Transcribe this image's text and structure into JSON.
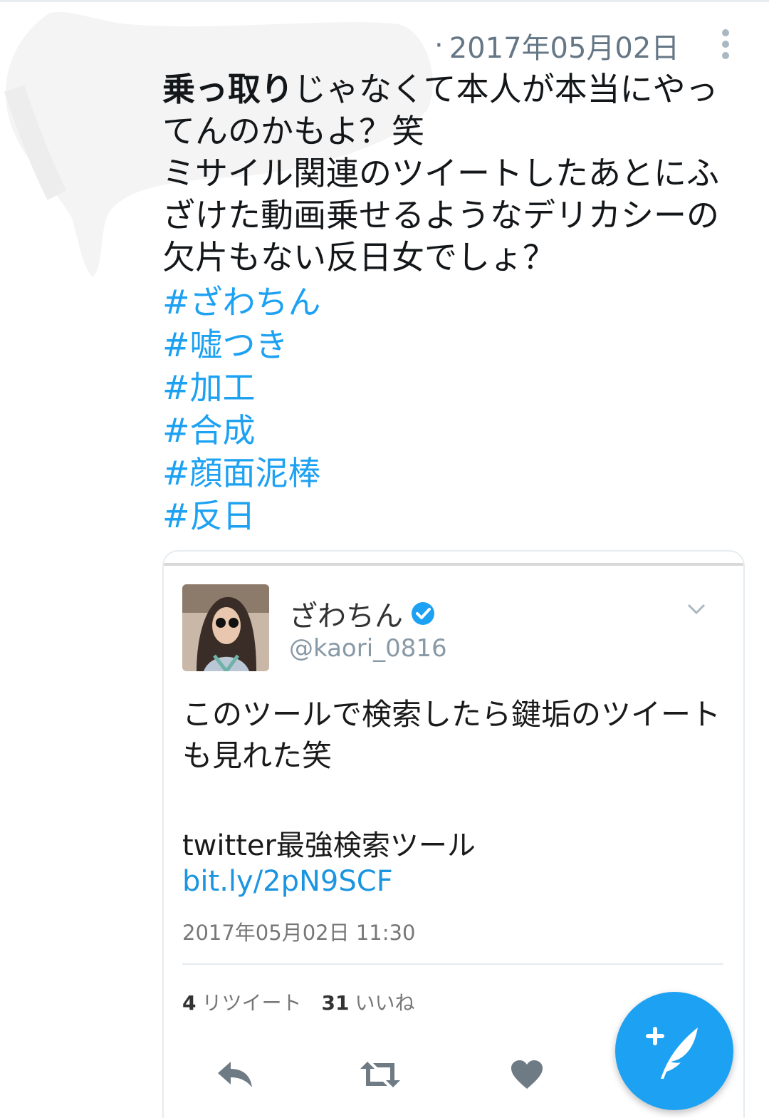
{
  "tweet": {
    "timestamp_separator": "·",
    "timestamp": "2017年05月02日",
    "text_bold": "乗っ取り",
    "text_rest": "じゃなくて本人が本当にやってんのかもよ？笑\nミサイル関連のツイートしたあとにふざけた動画乗せるようなデリカシーの欠片もない反日女でしょ？",
    "hashtags": [
      "#ざわちん",
      "#嘘つき",
      "#加工",
      "#合成",
      "#顔面泥棒",
      "#反日"
    ]
  },
  "embedded": {
    "display_name": "ざわちん",
    "handle": "@kaori_0816",
    "body": "このツールで検索したら鍵垢のツイートも見れた笑",
    "subtitle": "twitter最強検索ツール",
    "link": "bit.ly/2pN9SCF",
    "timestamp": "2017年05月02日 11:30",
    "retweet_count": "4",
    "retweet_label": "リツイート",
    "like_count": "31",
    "like_label": "いいね",
    "icons": [
      "verified-icon",
      "chevron-down-icon",
      "reply-icon",
      "retweet-icon",
      "heart-icon"
    ]
  },
  "fab": {
    "icon": "compose-tweet-icon"
  },
  "colors": {
    "accent": "#1da1f2",
    "text": "#14171a",
    "muted": "#657786",
    "border": "#e6ecf0"
  }
}
